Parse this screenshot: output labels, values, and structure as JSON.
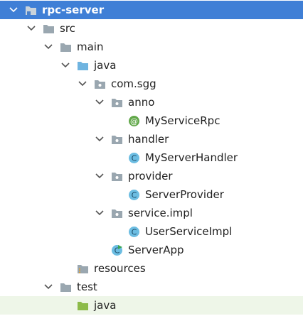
{
  "project_tree": {
    "root": {
      "label": "rpc-server"
    },
    "src": {
      "label": "src"
    },
    "main": {
      "label": "main"
    },
    "main_java": {
      "label": "java"
    },
    "package": {
      "label": "com.sgg"
    },
    "anno": {
      "label": "anno"
    },
    "my_service_rpc": {
      "label": "MyServiceRpc"
    },
    "handler": {
      "label": "handler"
    },
    "my_server_handler": {
      "label": "MyServerHandler"
    },
    "provider": {
      "label": "provider"
    },
    "server_provider": {
      "label": "ServerProvider"
    },
    "service_impl": {
      "label": "service.impl"
    },
    "user_service_impl": {
      "label": "UserServiceImpl"
    },
    "server_app": {
      "label": "ServerApp"
    },
    "resources": {
      "label": "resources"
    },
    "test": {
      "label": "test"
    },
    "test_java": {
      "label": "java"
    }
  },
  "colors": {
    "selection": "#3f7fd6",
    "hover_row": "#eef6e8",
    "folder": "#9aa7b0",
    "source_folder": "#6fb4e0",
    "test_folder": "#8dbb4a",
    "class_icon": "#6cbde2",
    "annotation_icon": "#62a84a"
  }
}
